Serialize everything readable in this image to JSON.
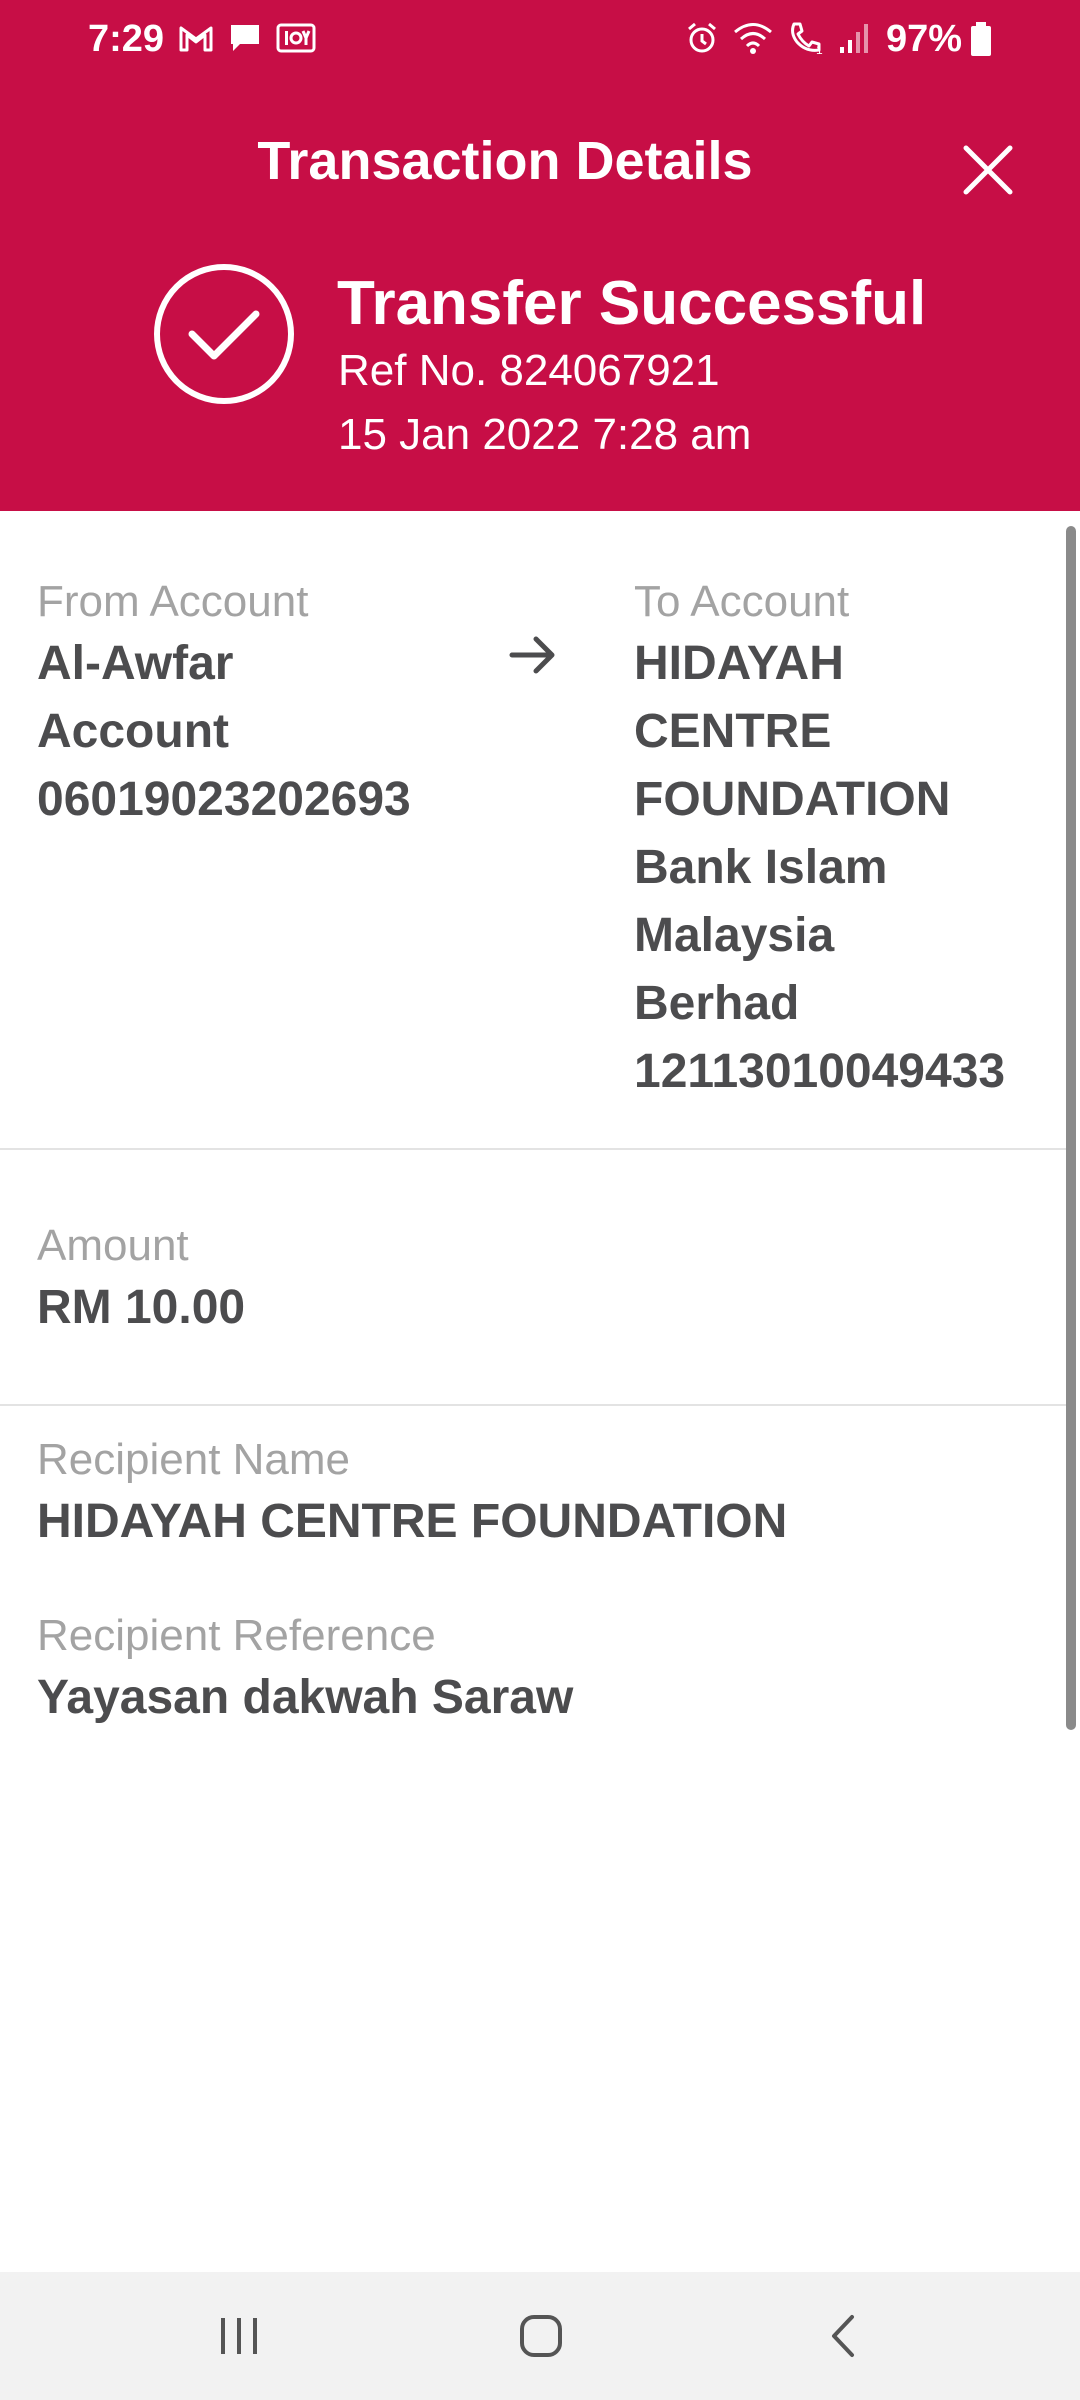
{
  "status_bar": {
    "time": "7:29",
    "battery": "97%",
    "left_icons": [
      "gmail-icon",
      "message-icon",
      "iqiyi-icon"
    ],
    "right_icons": [
      "alarm-icon",
      "wifi-icon",
      "wifi-calling-icon",
      "signal-icon",
      "battery-icon"
    ]
  },
  "header": {
    "title": "Transaction Details",
    "status_title": "Transfer Successful",
    "ref_no": "Ref No. 824067921",
    "datetime": "15 Jan 2022 7:28 am",
    "icons": {
      "close": "close-icon",
      "success": "check-circle-icon"
    }
  },
  "transfer": {
    "from_label": "From Account",
    "from_lines": [
      "Al-Awfar",
      "Account",
      "06019023202693"
    ],
    "to_label": "To Account",
    "to_lines": [
      "HIDAYAH",
      "CENTRE",
      "FOUNDATION",
      "Bank Islam",
      "Malaysia",
      "Berhad",
      "12113010049433"
    ]
  },
  "amount": {
    "label": "Amount",
    "value": "RM 10.00"
  },
  "recipient": {
    "name_label": "Recipient Name",
    "name_value": "HIDAYAH CENTRE FOUNDATION",
    "ref_label": "Recipient Reference",
    "ref_value": "Yayasan dakwah Saraw"
  },
  "nav": {
    "icons": [
      "recent-apps-icon",
      "home-icon",
      "back-icon"
    ]
  },
  "colors": {
    "brand": "#c70e46",
    "label": "#a3a3a3",
    "value": "#4c4c4e"
  }
}
